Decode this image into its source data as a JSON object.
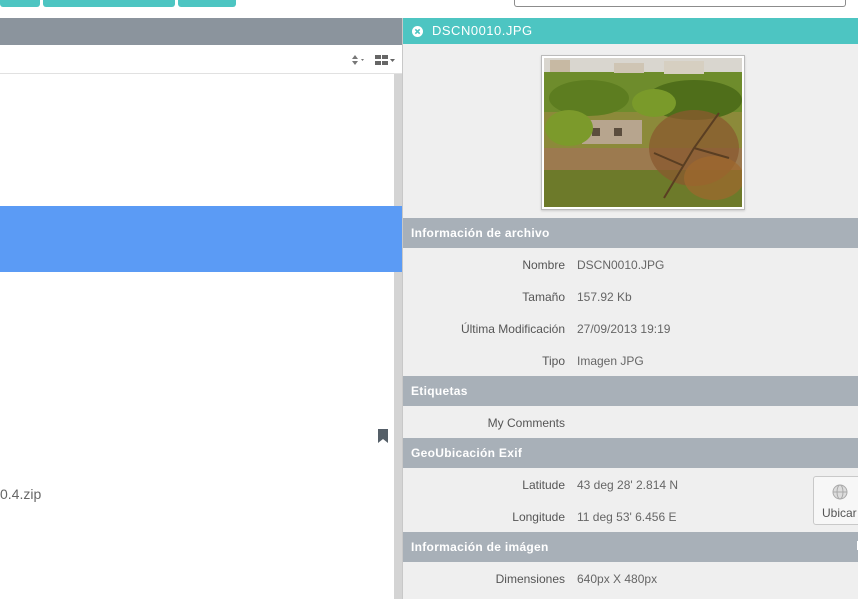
{
  "file_panel": {
    "title": "DSCN0010.JPG",
    "file_name_partial": "0.4.zip"
  },
  "sections": {
    "file_info": {
      "heading": "Información de archivo",
      "rows": [
        {
          "label": "Nombre",
          "value": "DSCN0010.JPG"
        },
        {
          "label": "Tamaño",
          "value": "157.92 Kb"
        },
        {
          "label": "Última Modificación",
          "value": "27/09/2013 19:19"
        },
        {
          "label": "Tipo",
          "value": "Imagen JPG"
        }
      ]
    },
    "tags": {
      "heading": "Etiquetas",
      "rows": [
        {
          "label": "My Comments",
          "value": ""
        }
      ]
    },
    "geo": {
      "heading": "GeoUbicación Exif",
      "rows": [
        {
          "label": "Latitude",
          "value": "43 deg 28' 2.814 N"
        },
        {
          "label": "Longitude",
          "value": "11 deg 53' 6.456 E"
        }
      ],
      "locate_button": "Ubicar"
    },
    "image_info": {
      "heading": "Información de imágen",
      "rows": [
        {
          "label": "Dimensiones",
          "value": "640px X 480px"
        }
      ]
    }
  },
  "icons": {
    "close": "close-circle-icon",
    "sort": "sort-icon",
    "view": "grid-view-icon",
    "bookmark": "bookmark-icon",
    "locate": "globe-icon"
  },
  "colors": {
    "accent": "#4dc5c2",
    "selection": "#5b9bf5",
    "section_header": "#a8b0b8",
    "left_header": "#8b949d"
  }
}
